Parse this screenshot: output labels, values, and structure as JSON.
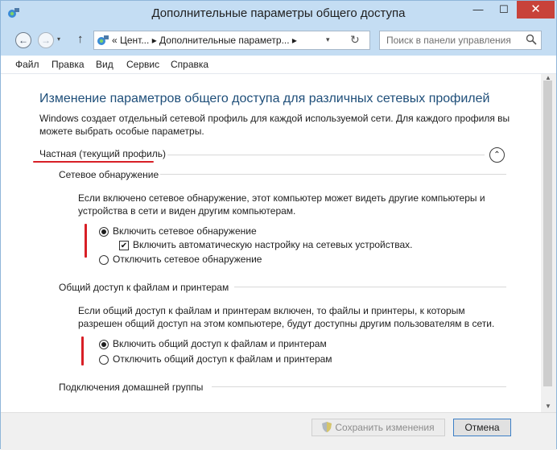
{
  "window": {
    "title": "Дополнительные параметры общего доступа",
    "minimize_glyph": "—",
    "maximize_glyph": "☐",
    "close_glyph": "✕"
  },
  "navigation": {
    "back_glyph": "←",
    "forward_glyph": "→",
    "recent_glyph": "▾",
    "up_glyph": "↑",
    "address_text": "«  Цент... ▸  Дополнительные параметр... ▸",
    "refresh_glyph": "↻",
    "search_placeholder": "Поиск в панели управления"
  },
  "menu": [
    "Файл",
    "Правка",
    "Вид",
    "Сервис",
    "Справка"
  ],
  "content": {
    "heading": "Изменение параметров общего доступа для различных сетевых профилей",
    "intro_line1": "Windows создает отдельный сетевой профиль для каждой используемой сети. Для каждого профиля вы",
    "intro_line2": "можете выбрать особые параметры.",
    "profile_title": "Частная (текущий профиль)",
    "collapse_glyph": "⌃",
    "network_discovery": {
      "title": "Сетевое обнаружение",
      "desc_line1": "Если включено сетевое обнаружение, этот компьютер может видеть другие компьютеры и",
      "desc_line2": "устройства в сети и виден другим компьютерам.",
      "option_on": "Включить сетевое обнаружение",
      "option_auto": "Включить автоматическую настройку на сетевых устройствах.",
      "option_off": "Отключить сетевое обнаружение",
      "selected": "on",
      "auto_checked": true
    },
    "file_sharing": {
      "title": "Общий доступ к файлам и принтерам",
      "desc_line1": "Если общий доступ к файлам и принтерам включен, то файлы и принтеры, к которым",
      "desc_line2": "разрешен общий доступ на этом компьютере, будут доступны другим пользователям в сети.",
      "option_on": "Включить общий доступ к файлам и принтерам",
      "option_off": "Отключить общий доступ к файлам и принтерам",
      "selected": "on"
    },
    "homegroup_title": "Подключения домашней группы"
  },
  "footer": {
    "save_label": "Сохранить изменения",
    "cancel_label": "Отмена",
    "save_enabled": false
  },
  "colors": {
    "titlebar": "#c4ddf3",
    "heading": "#1e4e79",
    "annotation_red": "#d81f26",
    "close_button": "#c8423a"
  }
}
